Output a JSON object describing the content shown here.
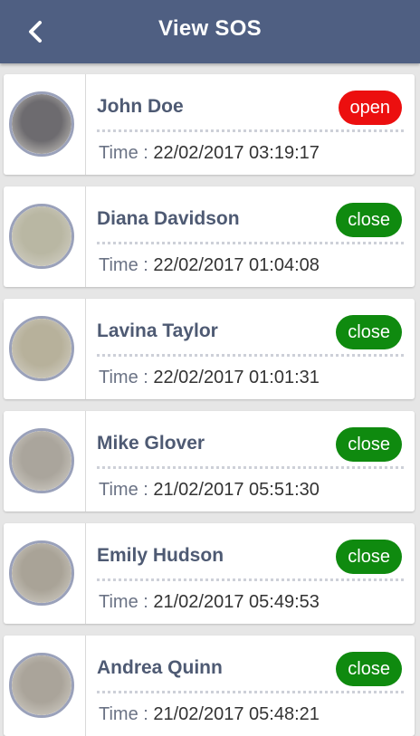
{
  "header": {
    "title": "View SOS",
    "back_icon": "chevron-left-icon"
  },
  "colors": {
    "header_bg": "#4f5f82",
    "open": "#ec0f0f",
    "close": "#0f8a0f",
    "name_text": "#4e5a73"
  },
  "time_label": "Time : ",
  "items": [
    {
      "name": "John Doe",
      "status": "open",
      "time": "22/02/2017 03:19:17",
      "avatar_tone": "#6d6b6f"
    },
    {
      "name": "Diana Davidson",
      "status": "close",
      "time": "22/02/2017 01:04:08",
      "avatar_tone": "#b9b7a3"
    },
    {
      "name": "Lavina Taylor",
      "status": "close",
      "time": "22/02/2017 01:01:31",
      "avatar_tone": "#b7b19b"
    },
    {
      "name": "Mike Glover",
      "status": "close",
      "time": "21/02/2017 05:51:30",
      "avatar_tone": "#aaa59c"
    },
    {
      "name": "Emily Hudson",
      "status": "close",
      "time": "21/02/2017 05:49:53",
      "avatar_tone": "#a9a397"
    },
    {
      "name": "Andrea Quinn",
      "status": "close",
      "time": "21/02/2017 05:48:21",
      "avatar_tone": "#aaa49a"
    }
  ]
}
